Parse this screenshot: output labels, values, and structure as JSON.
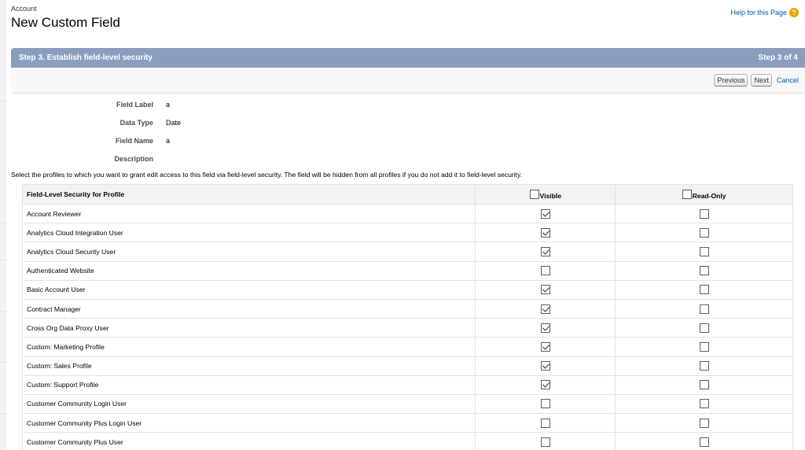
{
  "header": {
    "breadcrumb": "Account",
    "title": "New Custom Field",
    "help_link": "Help for this Page"
  },
  "step": {
    "title": "Step 3. Establish field-level security",
    "count": "Step 3 of 4"
  },
  "buttons": {
    "previous": "Previous",
    "next": "Next",
    "cancel": "Cancel"
  },
  "details": [
    {
      "label": "Field Label",
      "value": "a"
    },
    {
      "label": "Data Type",
      "value": "Date"
    },
    {
      "label": "Field Name",
      "value": "a"
    },
    {
      "label": "Description",
      "value": ""
    }
  ],
  "instructions": "Select the profiles to which you want to grant edit access to this field via field-level security. The field will be hidden from all profiles if you do not add it to field-level security.",
  "table": {
    "headers": {
      "profile": "Field-Level Security for Profile",
      "visible": "Visible",
      "read_only": "Read-Only"
    },
    "header_checks": {
      "visible": false,
      "read_only": false
    },
    "rows": [
      {
        "profile": "Account Reviewer",
        "visible": true,
        "read_only": false
      },
      {
        "profile": "Analytics Cloud Integration User",
        "visible": true,
        "read_only": false
      },
      {
        "profile": "Analytics Cloud Security User",
        "visible": true,
        "read_only": false
      },
      {
        "profile": "Authenticated Website",
        "visible": false,
        "read_only": false
      },
      {
        "profile": "Basic Account User",
        "visible": true,
        "read_only": false
      },
      {
        "profile": "Contract Manager",
        "visible": true,
        "read_only": false
      },
      {
        "profile": "Cross Org Data Proxy User",
        "visible": true,
        "read_only": false
      },
      {
        "profile": "Custom: Marketing Profile",
        "visible": true,
        "read_only": false
      },
      {
        "profile": "Custom: Sales Profile",
        "visible": true,
        "read_only": false
      },
      {
        "profile": "Custom: Support Profile",
        "visible": true,
        "read_only": false
      },
      {
        "profile": "Customer Community Login User",
        "visible": false,
        "read_only": false
      },
      {
        "profile": "Customer Community Plus Login User",
        "visible": false,
        "read_only": false
      },
      {
        "profile": "Customer Community Plus User",
        "visible": false,
        "read_only": false
      }
    ]
  },
  "colors": {
    "step_bar": "#8a9ebe",
    "link": "#015ba7",
    "help_icon": "#e8a300"
  },
  "icons": {
    "help": "help-circle-icon"
  }
}
